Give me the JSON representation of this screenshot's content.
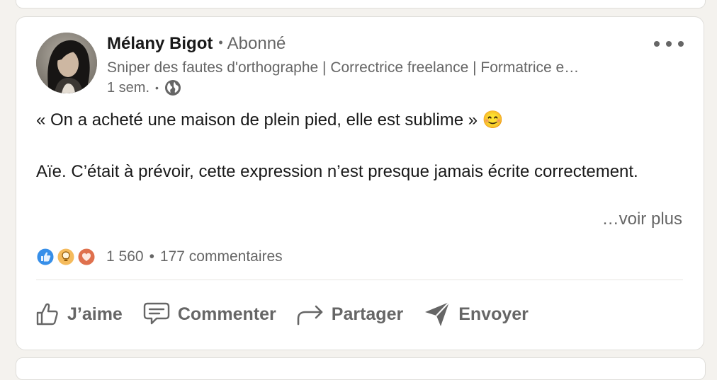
{
  "post": {
    "author": {
      "name": "Mélany Bigot",
      "follow_state": "Abonné",
      "headline": "Sniper des fautes d'orthographe | Correctrice freelance | Formatrice e…",
      "timestamp": "1 sem.",
      "visibility_icon": "globe-icon"
    },
    "more_menu_icon": "more-horizontal-icon",
    "body": {
      "line1": "« On a acheté une maison de plein pied, elle est sublime » ",
      "emoji": "😊",
      "line2": "Aïe. C’était à prévoir, cette expression n’est presque jamais écrite correctement."
    },
    "see_more": "…voir plus",
    "social": {
      "reaction_icons": [
        "like-icon",
        "insightful-icon",
        "love-icon"
      ],
      "reaction_count": "1 560",
      "comments": "177 commentaires"
    },
    "actions": {
      "like": "J’aime",
      "comment": "Commenter",
      "share": "Partager",
      "send": "Envoyer"
    }
  },
  "colors": {
    "page_background": "#f4f2ee",
    "card_background": "#ffffff",
    "text_primary": "#191919",
    "text_secondary": "#666666",
    "like_blue": "#378fe9",
    "insightful_yellow": "#f5bb5c",
    "love_red": "#df704d"
  }
}
